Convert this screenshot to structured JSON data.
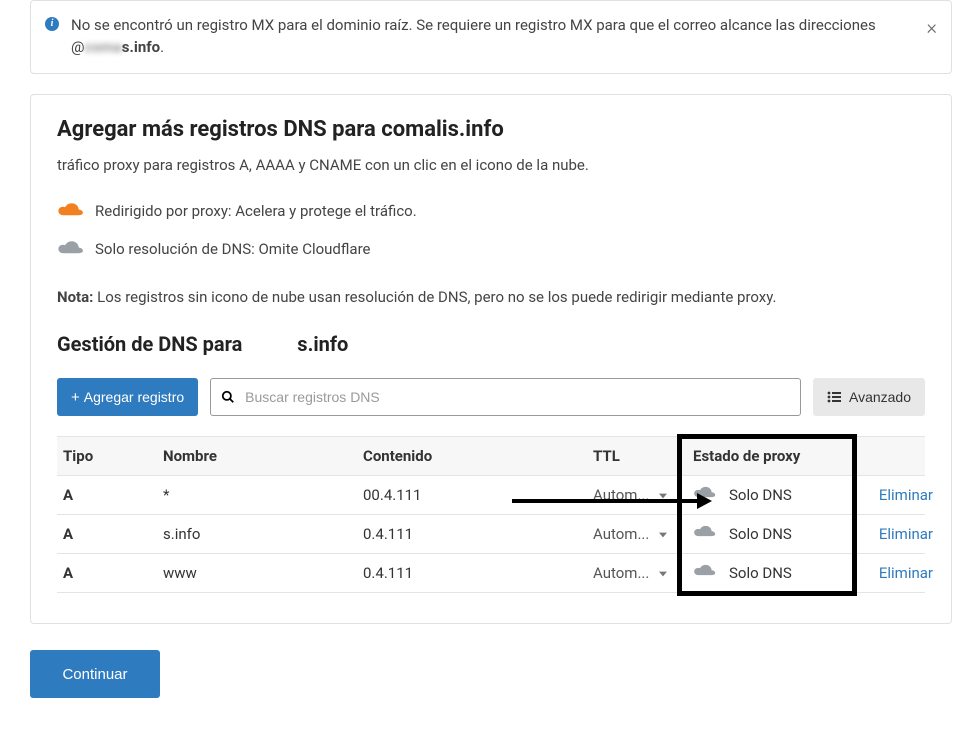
{
  "alert": {
    "text_before": "No se encontró un registro MX para el dominio raíz. Se requiere un registro MX para que el correo alcance las direcciones @",
    "redacted_domain_suffix": "s.info",
    "text_after": "."
  },
  "card": {
    "title": "Agregar más registros DNS para comalis.info",
    "intro": "tráfico proxy para registros A, AAAA y CNAME con un clic en el icono de la nube.",
    "legend_proxy": "Redirigido por proxy: Acelera y protege el tráfico.",
    "legend_dns_only": "Solo resolución de DNS: Omite Cloudflare",
    "note_label": "Nota:",
    "note_text": " Los registros sin icono de nube usan resolución de DNS, pero no se los puede redirigir mediante proxy.",
    "mgmt_title_prefix": "Gestión de DNS para ",
    "mgmt_title_suffix": "s.info"
  },
  "toolbar": {
    "add_label": "Agregar registro",
    "search_placeholder": "Buscar registros DNS",
    "advanced_label": "Avanzado"
  },
  "table": {
    "headers": {
      "type": "Tipo",
      "name": "Nombre",
      "content": "Contenido",
      "ttl": "TTL",
      "proxy": "Estado de proxy"
    },
    "rows": [
      {
        "type": "A",
        "name": "*",
        "content": "00.4.111",
        "ttl": "Autom...",
        "proxy": "Solo DNS",
        "delete": "Eliminar"
      },
      {
        "type": "A",
        "name": "s.info",
        "content": "0.4.111",
        "ttl": "Autom...",
        "proxy": "Solo DNS",
        "delete": "Eliminar"
      },
      {
        "type": "A",
        "name": "www",
        "content": "0.4.111",
        "ttl": "Autom...",
        "proxy": "Solo DNS",
        "delete": "Eliminar"
      }
    ]
  },
  "continue_label": "Continuar",
  "colors": {
    "accent": "#2f7bbf",
    "cloud_orange": "#f38020",
    "cloud_grey": "#9aa0a6"
  }
}
